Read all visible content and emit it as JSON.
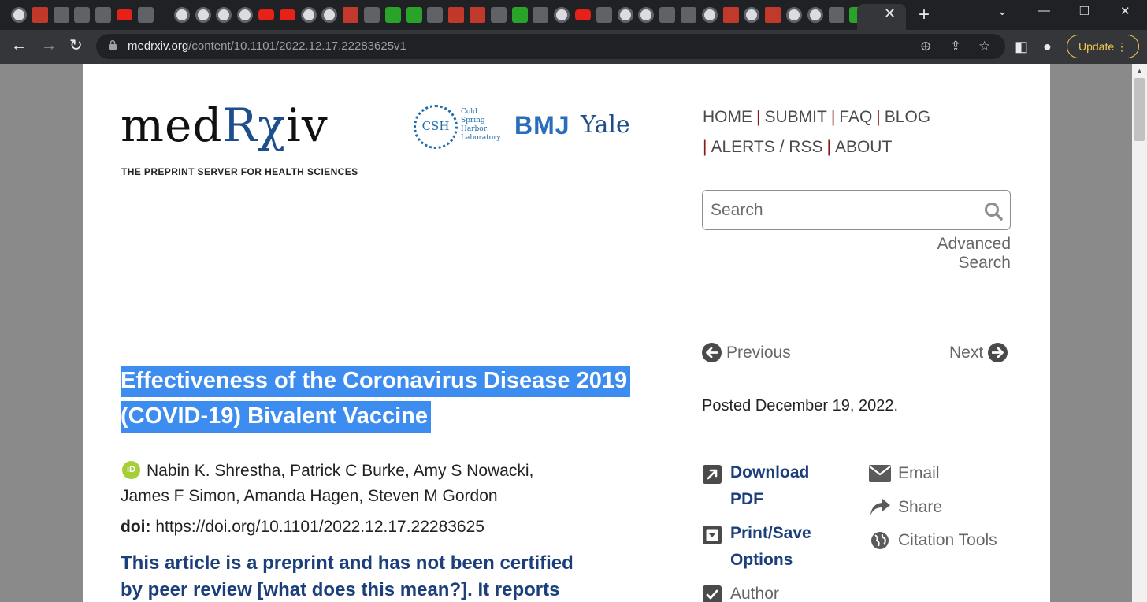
{
  "browser": {
    "tab_close": "✕",
    "new_tab": "+",
    "update_label": "Update",
    "update_dots": "⋮"
  },
  "address_bar": {
    "host": "medrxiv.org",
    "path": "/content/10.1101/2022.12.17.22283625v1"
  },
  "site": {
    "logo_text_pre": "med",
    "logo_text_rx": "Rχ",
    "logo_text_post": "iv",
    "tagline": "THE PREPRINT SERVER FOR HEALTH SCIENCES",
    "partner_csh_abbr": "CSH",
    "partner_csh_lines": [
      "Cold",
      "Spring",
      "Harbor",
      "Laboratory"
    ],
    "partner_bmj": "BMJ",
    "partner_yale": "Yale"
  },
  "nav": {
    "items": [
      "HOME",
      "SUBMIT",
      "FAQ",
      "BLOG",
      "ALERTS / RSS",
      "ABOUT"
    ],
    "sep": "|"
  },
  "search": {
    "placeholder": "Search",
    "advanced_label": "Advanced Search"
  },
  "pager": {
    "previous": "Previous",
    "next": "Next"
  },
  "article": {
    "title_line1": "Effectiveness of the Coronavirus Disease 2019",
    "title_line2": "(COVID-19) Bivalent Vaccine",
    "authors_line1": "Nabin K. Shrestha, Patrick C Burke, Amy S Nowacki,",
    "authors_line2": "James F Simon, Amanda Hagen, Steven M Gordon",
    "orcid_label": "iD",
    "doi_label": "doi:",
    "doi_value": "https://doi.org/10.1101/2022.12.17.22283625",
    "notice_line1": "This article is a preprint and has not been certified",
    "notice_line2": "by peer review [what does this mean?]. It reports",
    "posted": "Posted December 19, 2022."
  },
  "actions": {
    "download_line1": "Download",
    "download_line2": "PDF",
    "print_line1": "Print/Save",
    "print_line2": "Options",
    "author": "Author",
    "email": "Email",
    "share": "Share",
    "citation": "Citation Tools"
  },
  "colors": {
    "brand_blue": "#1b3f7a",
    "title_highlight": "#3d8cf0",
    "nav_separator": "#8b1a1a",
    "update_accent": "#f2c94c"
  }
}
